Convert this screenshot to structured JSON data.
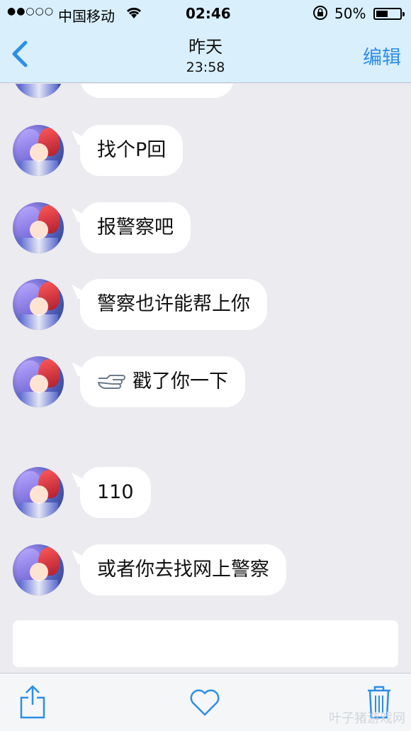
{
  "status_bar": {
    "signal": "●●○○○",
    "carrier": "中国移动",
    "time": "02:46",
    "battery_percent": "50%",
    "battery_level": 0.5
  },
  "nav": {
    "title": "昨天",
    "subtitle": "23:58",
    "edit_label": "编辑"
  },
  "messages": [
    {
      "text": "找个P回"
    },
    {
      "text": "报警察吧"
    },
    {
      "text": "警察也许能帮上你"
    },
    {
      "text": "戳了你一下",
      "icon": "poke-hand-icon"
    },
    {
      "text": "110"
    },
    {
      "text": "或者你去找网上警察"
    }
  ],
  "watermark": "叶子猪游戏网",
  "colors": {
    "accent": "#2d8ee8",
    "nav_bg": "#d9effb",
    "chat_bg": "#ebebf0",
    "bubble_bg": "#ffffff"
  }
}
